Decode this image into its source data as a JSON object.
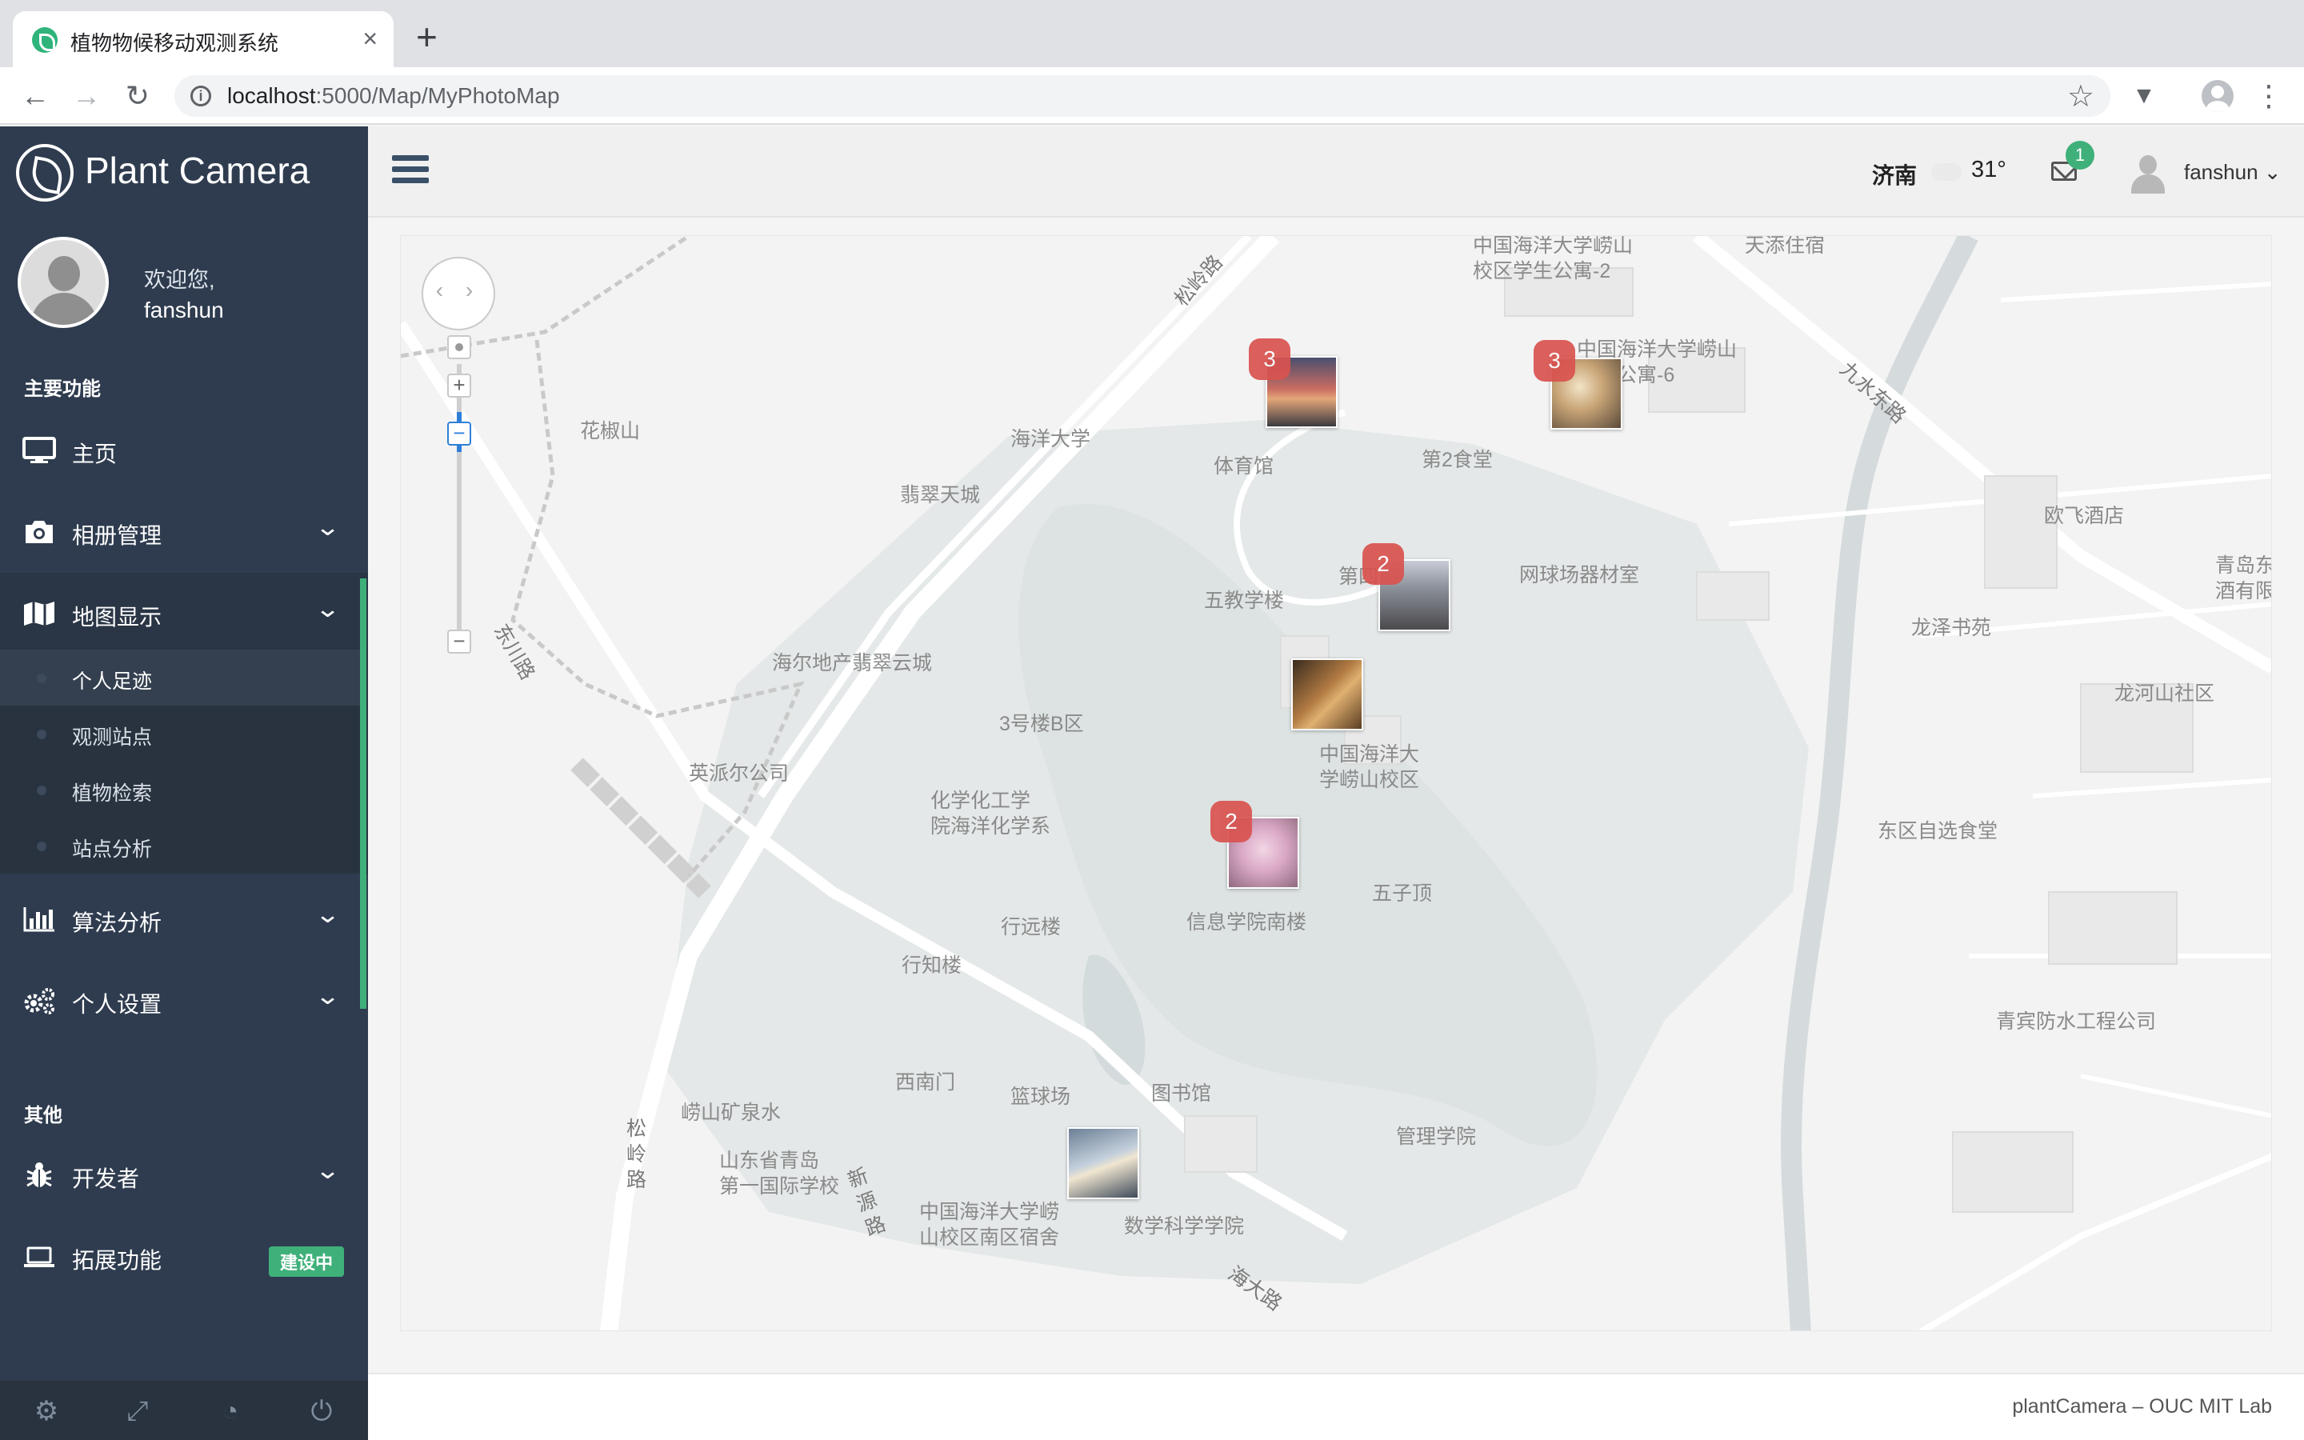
{
  "browser": {
    "tab_title": "植物物候移动观测系统",
    "tab_close": "×",
    "new_tab": "+",
    "url_host": "localhost",
    "url_path": ":5000/Map/MyPhotoMap",
    "back": "←",
    "forward": "→",
    "reload": "↻",
    "star": "☆",
    "extension": "▼",
    "menu": "⋮"
  },
  "sidebar": {
    "brand": "Plant Camera",
    "welcome": "欢迎您,",
    "username": "fanshun",
    "section_main": "主要功能",
    "section_other": "其他",
    "items": [
      {
        "label": "主页",
        "icon": "monitor-icon"
      },
      {
        "label": "相册管理",
        "icon": "camera-icon",
        "chevron": "⌄"
      },
      {
        "label": "地图显示",
        "icon": "map-icon",
        "chevron": "⌄"
      },
      {
        "label": "算法分析",
        "icon": "bar-chart-icon",
        "chevron": "⌄"
      },
      {
        "label": "个人设置",
        "icon": "gears-icon",
        "chevron": "⌄"
      },
      {
        "label": "开发者",
        "icon": "bug-icon",
        "chevron": "⌄"
      },
      {
        "label": "拓展功能",
        "icon": "laptop-icon",
        "badge": "建设中"
      }
    ],
    "submenu": [
      {
        "label": "个人足迹",
        "selected": true
      },
      {
        "label": "观测站点"
      },
      {
        "label": "植物检索"
      },
      {
        "label": "站点分析"
      }
    ],
    "footer_icons": [
      "settings-icon",
      "fullscreen-icon",
      "eye-slash-icon",
      "power-icon"
    ],
    "colors": {
      "bg": "#2f3c4f",
      "accent": "#3fb07a"
    }
  },
  "header": {
    "city": "济南",
    "temperature": "31°",
    "mail_count": "1",
    "user": "fanshun ⌄"
  },
  "map": {
    "labels": {
      "l1": "中国海洋大学崂山\n校区学生公寓-2",
      "l2": "天添住宿",
      "l3": "松岭路",
      "l4": "中国海洋大学崂山\n学生公寓-6",
      "l5": "九水东路",
      "l6": "花椒山",
      "l7": "海洋大学",
      "l8": "体育馆",
      "l9": "第2食堂",
      "l10": "翡翠天城",
      "l11": "欧飞酒店",
      "l12": "青岛东\n酒有限",
      "l13": "第四",
      "l14": "网球场器材室",
      "l15": "五教学楼",
      "l16": "龙泽书苑",
      "l17": "东川路",
      "l18": "海尔地产翡翠云城",
      "l19": "龙河山社区",
      "l20": "3号楼B区",
      "l21": "中国海洋大\n学崂山校区",
      "l22": "英派尔公司",
      "l23": "化学化工学\n院海洋化学系",
      "l24": "东区自选食堂",
      "l25": "五子顶",
      "l26": "行远楼",
      "l27": "信息学院南楼",
      "l28": "行知楼",
      "l29": "青宾防水工程公司",
      "l30": "西南门",
      "l31": "篮球场",
      "l32": "图书馆",
      "l33": "崂山矿泉水",
      "l34": "松\n岭\n路",
      "l35": "管理学院",
      "l36": "山东省青岛\n第一国际学校",
      "l37": "新\n源\n路",
      "l38": "中国海洋大学崂\n山校区南区宿舍",
      "l39": "数学科学学院",
      "l40": "海大路"
    },
    "zoom_in": "+",
    "zoom_out": "−",
    "markers": [
      {
        "count": "3",
        "color": "#d36a5a"
      },
      {
        "count": "3",
        "color": "#c9a577"
      },
      {
        "count": "2",
        "color": "#6b6e74"
      },
      {
        "count": "",
        "color": "#a0703a"
      },
      {
        "count": "2",
        "color": "#d9a7c3"
      },
      {
        "count": "",
        "color": "#8fa3b8"
      }
    ]
  },
  "footer": {
    "text": "plantCamera – OUC MIT Lab"
  }
}
